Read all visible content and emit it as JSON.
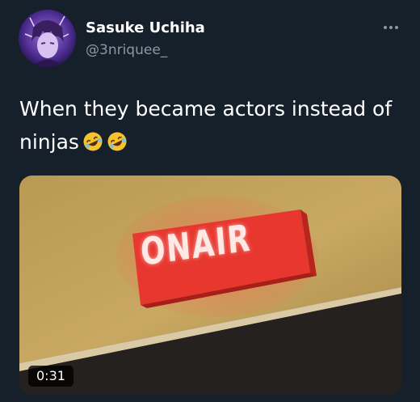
{
  "user": {
    "display_name": "Sasuke Uchiha",
    "handle": "@3nriquee_"
  },
  "menu": {
    "icon": "more-horizontal-icon"
  },
  "tweet": {
    "text": "When they became actors instead of ninjas",
    "emojis": [
      "rolling-on-floor-laughing-emoji",
      "rolling-on-floor-laughing-emoji"
    ]
  },
  "media": {
    "sign_text": "ONAIR",
    "duration": "0:31"
  },
  "colors": {
    "background": "#15202b",
    "secondary_text": "#8b98a5",
    "sign_red": "#e8372f"
  }
}
